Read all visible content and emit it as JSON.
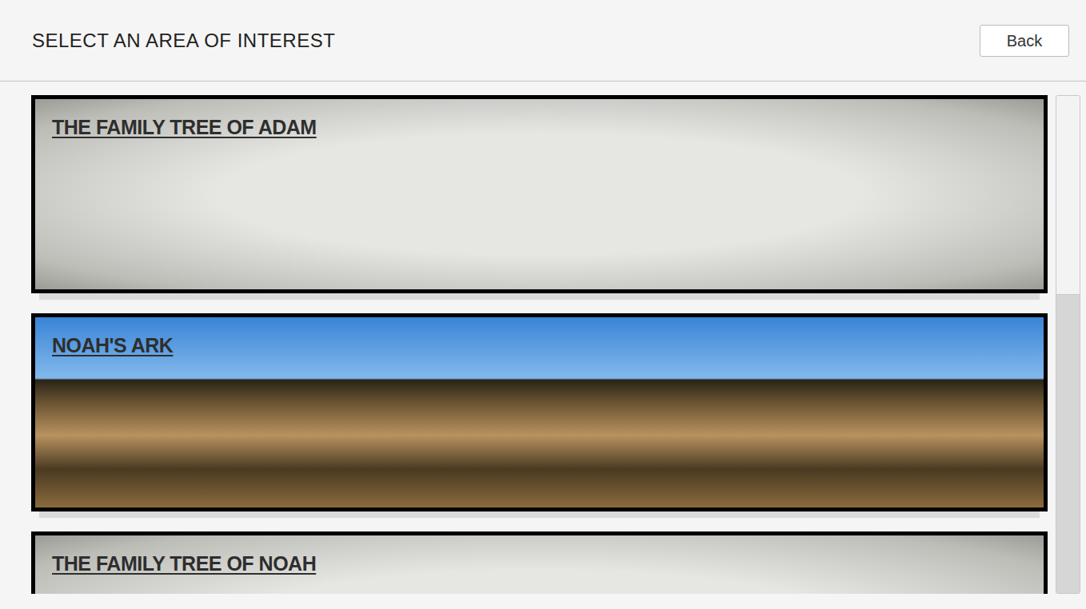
{
  "header": {
    "title": "SELECT AN AREA OF INTEREST",
    "back_button": "Back"
  },
  "cards": [
    {
      "title": "THE FAMILY TREE OF ADAM",
      "kind": "paper"
    },
    {
      "title": "NOAH'S ARK",
      "kind": "ark"
    },
    {
      "title": "THE FAMILY TREE OF NOAH",
      "kind": "paper"
    }
  ],
  "scrollbar": {
    "level": 0.4
  }
}
